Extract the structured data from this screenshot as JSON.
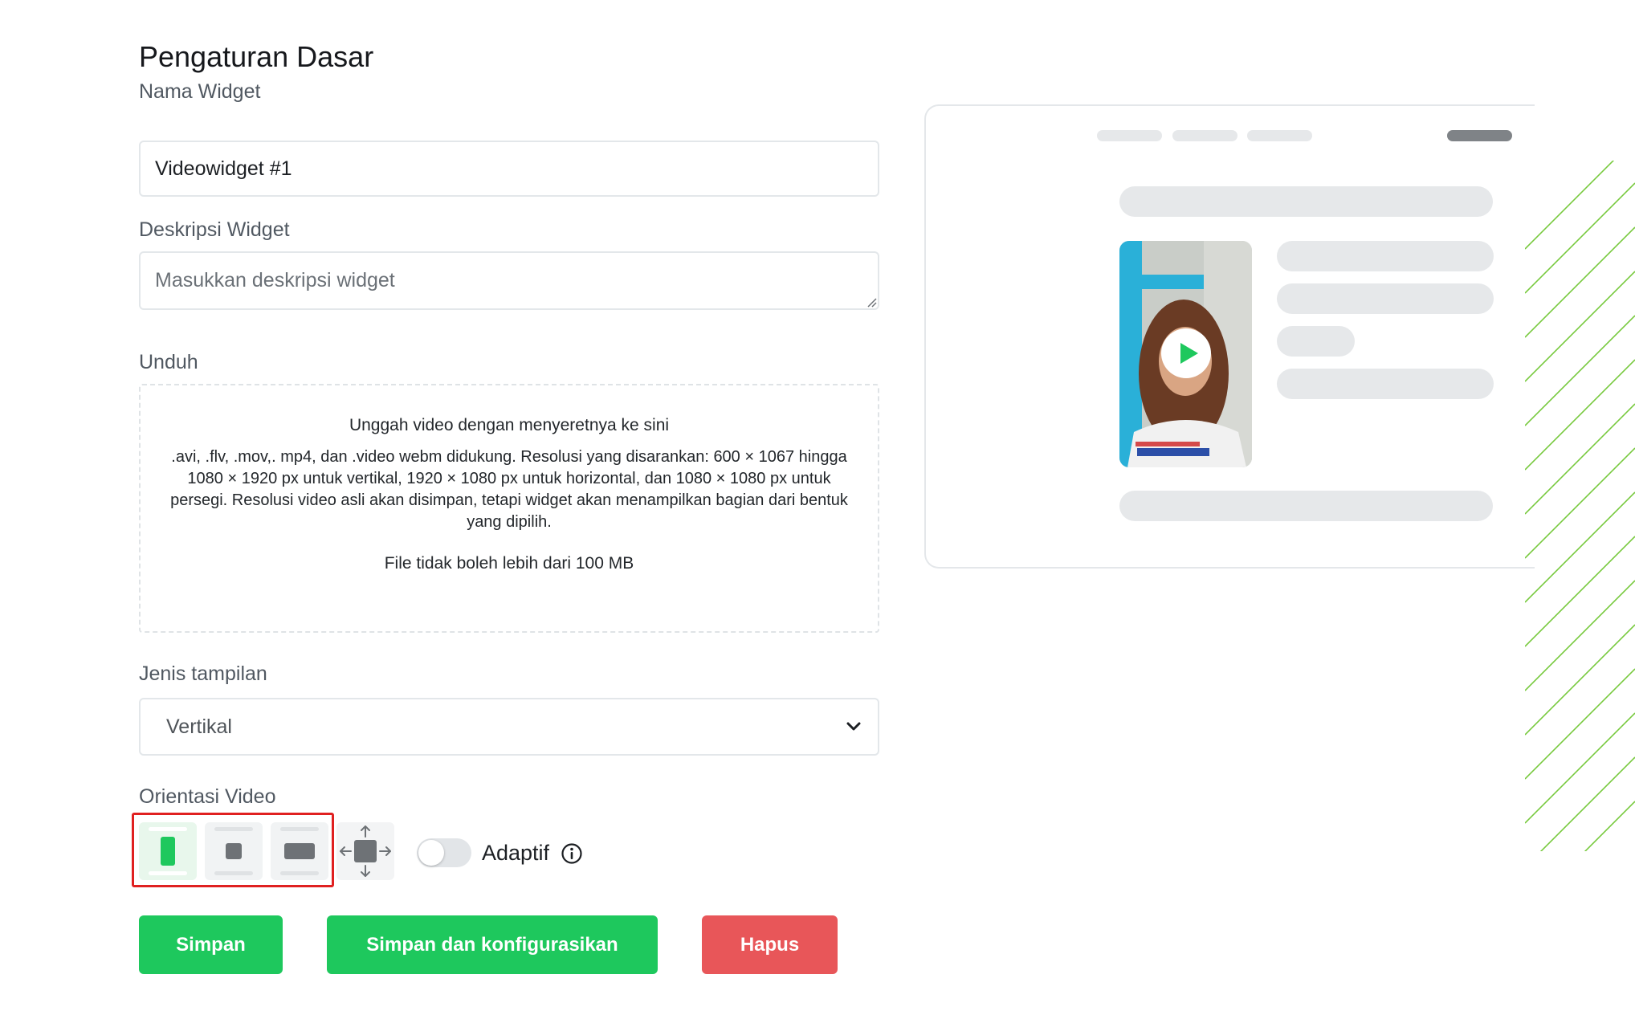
{
  "page": {
    "title": "Pengaturan Dasar"
  },
  "form": {
    "name": {
      "label": "Nama Widget",
      "value": "Videowidget #1"
    },
    "description": {
      "label": "Deskripsi Widget",
      "placeholder": "Masukkan deskripsi widget"
    },
    "upload": {
      "label": "Unduh",
      "title": "Unggah video dengan menyeretnya ke sini",
      "description": ".avi, .flv, .mov,. mp4, dan .video webm didukung. Resolusi yang disarankan: 600 × 1067 hingga 1080 × 1920 px untuk vertikal, 1920 × 1080 px untuk horizontal, dan 1080 × 1080 px untuk persegi. Resolusi video asli akan disimpan, tetapi widget akan menampilkan bagian dari bentuk yang dipilih.",
      "limit": "File tidak boleh lebih dari 100 MB"
    },
    "display_type": {
      "label": "Jenis tampilan",
      "selected": "Vertikal"
    },
    "orientation": {
      "label": "Orientasi Video",
      "options": [
        "vertical",
        "square",
        "horizontal",
        "adaptive-resize"
      ],
      "selected": "vertical",
      "adaptive_toggle": {
        "label": "Adaptif",
        "on": false
      }
    },
    "buttons": {
      "save": "Simpan",
      "save_configure": "Simpan dan konfigurasikan",
      "delete": "Hapus"
    }
  },
  "colors": {
    "primary_green": "#1ec85d",
    "danger_red": "#e85659",
    "highlight_red": "#e02020",
    "skeleton": "#e6e8ea"
  },
  "preview": {
    "has_play_icon": true
  }
}
